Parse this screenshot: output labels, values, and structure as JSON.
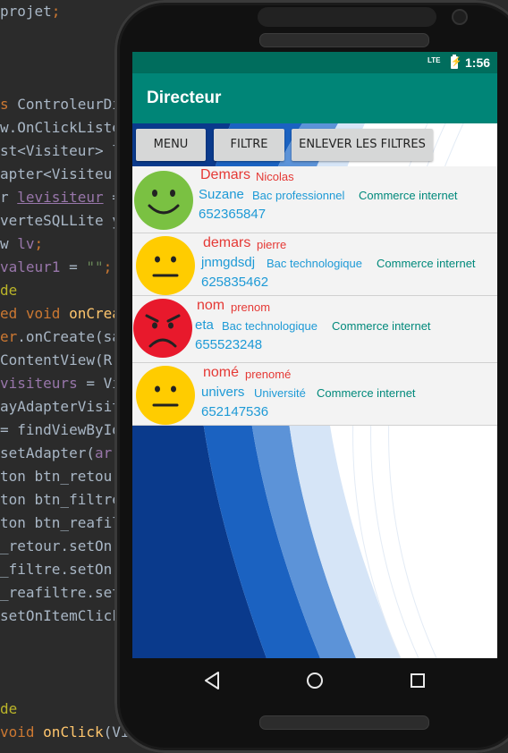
{
  "code_lines": [
    {
      "parts": [
        {
          "t": "projet",
          "c": ""
        },
        {
          "t": ";",
          "c": "kw"
        }
      ]
    },
    {
      "parts": [
        {
          "t": "",
          "c": ""
        }
      ]
    },
    {
      "parts": [
        {
          "t": "",
          "c": ""
        }
      ]
    },
    {
      "parts": [
        {
          "t": "",
          "c": ""
        }
      ]
    },
    {
      "parts": [
        {
          "t": "s ",
          "c": "kw"
        },
        {
          "t": "ControleurDi",
          "c": ""
        }
      ]
    },
    {
      "parts": [
        {
          "t": "w.OnClickListe",
          "c": ""
        }
      ]
    },
    {
      "parts": [
        {
          "t": "st<Visiteur> l",
          "c": ""
        }
      ]
    },
    {
      "parts": [
        {
          "t": "apter<Visiteur",
          "c": ""
        }
      ]
    },
    {
      "parts": [
        {
          "t": "r ",
          "c": ""
        },
        {
          "t": "levisiteur",
          "c": "fld ul"
        },
        {
          "t": " =",
          "c": ""
        }
      ]
    },
    {
      "parts": [
        {
          "t": "verteSQLLite y",
          "c": ""
        }
      ]
    },
    {
      "parts": [
        {
          "t": "w ",
          "c": ""
        },
        {
          "t": "lv",
          "c": "fld"
        },
        {
          "t": ";",
          "c": "kw"
        }
      ]
    },
    {
      "parts": [
        {
          "t": "valeur1",
          "c": "fld"
        },
        {
          "t": " = ",
          "c": ""
        },
        {
          "t": "\"\"",
          "c": "str"
        },
        {
          "t": ";",
          "c": "kw"
        }
      ]
    },
    {
      "parts": [
        {
          "t": "de",
          "c": "ann"
        }
      ]
    },
    {
      "parts": [
        {
          "t": "ed void ",
          "c": "kw"
        },
        {
          "t": "onCrea",
          "c": "fn"
        }
      ]
    },
    {
      "parts": [
        {
          "t": "er",
          "c": "kw"
        },
        {
          "t": ".onCreate(sa",
          "c": ""
        }
      ]
    },
    {
      "parts": [
        {
          "t": "ContentView(R",
          "c": ""
        }
      ]
    },
    {
      "parts": [
        {
          "t": "visiteurs",
          "c": "fld"
        },
        {
          "t": " = Vi",
          "c": ""
        }
      ]
    },
    {
      "parts": [
        {
          "t": "ayAdapterVisit",
          "c": ""
        }
      ]
    },
    {
      "parts": [
        {
          "t": "= findViewById",
          "c": ""
        }
      ]
    },
    {
      "parts": [
        {
          "t": "setAdapter(",
          "c": ""
        },
        {
          "t": "ar",
          "c": "fld"
        }
      ]
    },
    {
      "parts": [
        {
          "t": "ton btn_retour",
          "c": ""
        }
      ]
    },
    {
      "parts": [
        {
          "t": "ton btn_filtre",
          "c": ""
        }
      ]
    },
    {
      "parts": [
        {
          "t": "ton btn_reafil",
          "c": ""
        }
      ]
    },
    {
      "parts": [
        {
          "t": "_retour.setOn",
          "c": ""
        }
      ]
    },
    {
      "parts": [
        {
          "t": "_filtre.setOn",
          "c": ""
        }
      ]
    },
    {
      "parts": [
        {
          "t": "_reafiltre.set",
          "c": ""
        }
      ]
    },
    {
      "parts": [
        {
          "t": "setOnItemClick",
          "c": ""
        }
      ]
    },
    {
      "parts": [
        {
          "t": "",
          "c": ""
        }
      ]
    },
    {
      "parts": [
        {
          "t": "",
          "c": ""
        }
      ]
    },
    {
      "parts": [
        {
          "t": "",
          "c": ""
        }
      ]
    },
    {
      "parts": [
        {
          "t": "de",
          "c": "ann"
        }
      ]
    },
    {
      "parts": [
        {
          "t": "void ",
          "c": "kw"
        },
        {
          "t": "onClick",
          "c": "fn"
        },
        {
          "t": "(Vi",
          "c": ""
        }
      ]
    }
  ],
  "status": {
    "network": "LTE",
    "time": "1:56"
  },
  "appbar": {
    "title": "Directeur"
  },
  "buttons": {
    "menu": "MENU",
    "filtre": "FILTRE",
    "enlever": "ENLEVER LES FILTRES"
  },
  "visiteurs": [
    {
      "nom": "Demars",
      "prenom": "Nicolas",
      "ville": "Suzane",
      "bac": "Bac professionnel",
      "option": "Commerce internet",
      "tel": "652365847",
      "mood": "happy"
    },
    {
      "nom": "demars",
      "prenom": "pierre",
      "ville": "jnmgdsdj",
      "bac": "Bac technologique",
      "option": "Commerce internet",
      "tel": "625835462",
      "mood": "neutral"
    },
    {
      "nom": "nom",
      "prenom": "prenom",
      "ville": "eta",
      "bac": "Bac technologique",
      "option": "Commerce internet",
      "tel": "655523248",
      "mood": "sad"
    },
    {
      "nom": "nomé",
      "prenom": "prenomé",
      "ville": "univers",
      "bac": "Université",
      "option": "Commerce internet",
      "tel": "652147536",
      "mood": "neutral"
    }
  ],
  "colors": {
    "primary": "#008577",
    "primary_dark": "#006d5d",
    "name_red": "#e53935",
    "info_blue": "#1e9ad6",
    "option_teal": "#00897b",
    "happy_green": "#7ac142",
    "neutral_yellow": "#ffcc00",
    "sad_red": "#e8192c"
  },
  "nav": {
    "back_icon": "back-triangle-icon",
    "home_icon": "home-circle-icon",
    "recents_icon": "recents-square-icon"
  }
}
